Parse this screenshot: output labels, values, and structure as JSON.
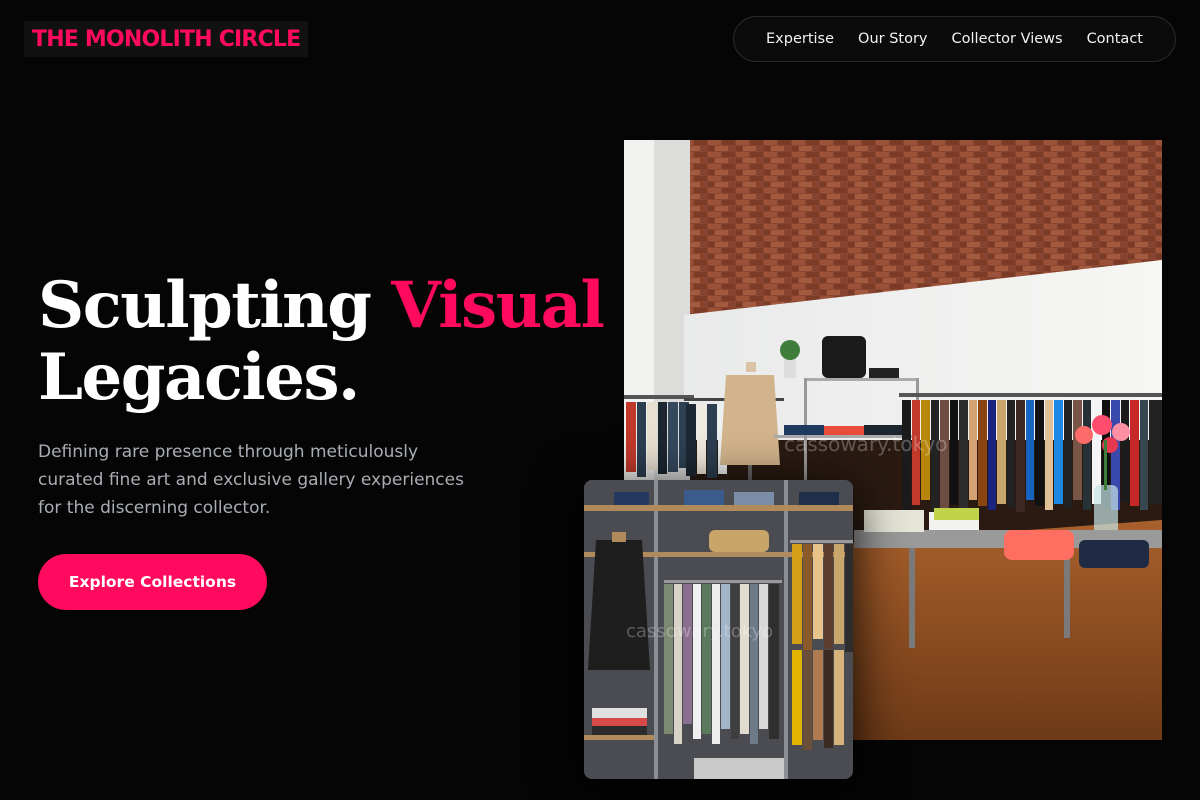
{
  "brand": {
    "name": "THE MONOLITH CIRCLE"
  },
  "nav": {
    "items": [
      {
        "label": "Expertise"
      },
      {
        "label": "Our Story"
      },
      {
        "label": "Collector Views"
      },
      {
        "label": "Contact"
      }
    ]
  },
  "hero": {
    "headline_part1": "Sculpting",
    "headline_accent": "Visual",
    "headline_part2": "Legacies.",
    "subtitle": "Defining rare presence through meticulously curated fine art and exclusive gallery experiences for the discerning collector.",
    "cta_label": "Explore Collections"
  },
  "images": {
    "main_watermark": "cassowary.tokyo",
    "secondary_watermark": "cassowary.tokyo"
  },
  "colors": {
    "accent": "#ff0a5e",
    "background": "#050505",
    "subtitle": "#a9adb4"
  }
}
